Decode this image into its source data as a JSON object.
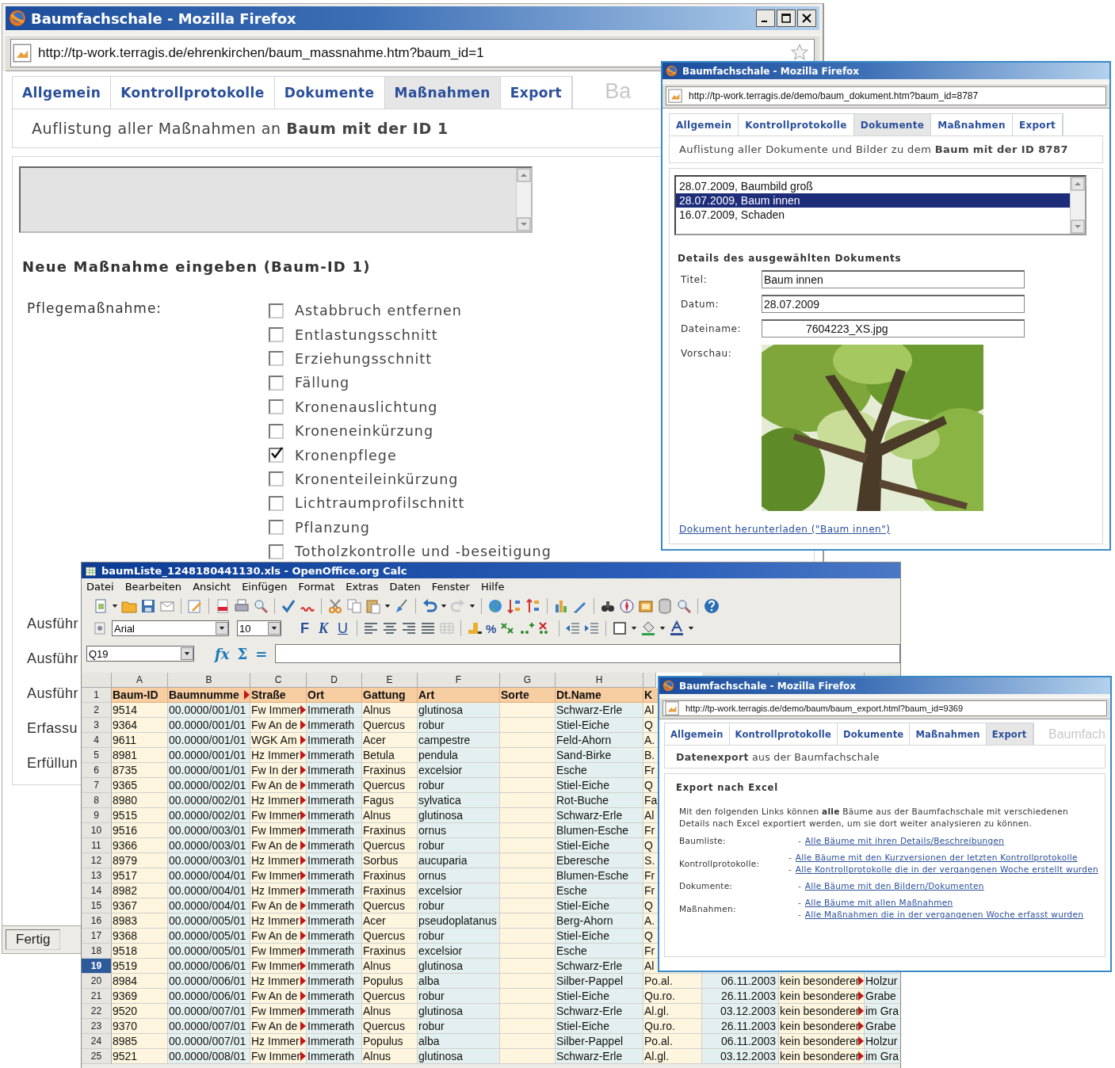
{
  "main_window": {
    "title": "Baumfachschale - Mozilla Firefox",
    "url": "http://tp-work.terragis.de/ehrenkirchen/baum_massnahme.htm?baum_id=1",
    "tabs": [
      {
        "label": "Allgemein",
        "selected": false
      },
      {
        "label": "Kontrollprotokolle",
        "selected": false
      },
      {
        "label": "Dokumente",
        "selected": false
      },
      {
        "label": "Maßnahmen",
        "selected": true
      },
      {
        "label": "Export",
        "selected": false
      }
    ],
    "logo": "Ba",
    "subtitle": "Auflistung aller Maßnahmen an **Baum mit der ID 1**",
    "form_title": "Neue Maßnahme eingeben (Baum-ID 1)",
    "care_label": "Pflegemaßnahme:",
    "care_options": [
      {
        "label": "Astabbruch entfernen",
        "checked": false
      },
      {
        "label": "Entlastungsschnitt",
        "checked": false
      },
      {
        "label": "Erziehungsschnitt",
        "checked": false
      },
      {
        "label": "Fällung",
        "checked": false
      },
      {
        "label": "Kronenauslichtung",
        "checked": false
      },
      {
        "label": "Kroneneinkürzung",
        "checked": false
      },
      {
        "label": "Kronenpflege",
        "checked": true
      },
      {
        "label": "Kronenteileinkürzung",
        "checked": false
      },
      {
        "label": "Lichtraumprofilschnitt",
        "checked": false
      },
      {
        "label": "Pflanzung",
        "checked": false
      },
      {
        "label": "Totholzkontrolle und -beseitigung",
        "checked": false
      }
    ],
    "field_labels": [
      "Ausführ",
      "Ausführ",
      "Ausführ",
      "Erfassu",
      "Erfüllun"
    ],
    "status": "Fertig"
  },
  "document_window": {
    "title": "Baumfachschale - Mozilla Firefox",
    "url": "http://tp-work.terragis.de/demo/baum_dokument.htm?baum_id=8787",
    "tabs": [
      {
        "label": "Allgemein",
        "selected": false
      },
      {
        "label": "Kontrollprotokolle",
        "selected": false
      },
      {
        "label": "Dokumente",
        "selected": true
      },
      {
        "label": "Maßnahmen",
        "selected": false
      },
      {
        "label": "Export",
        "selected": false
      }
    ],
    "subtitle": "Auflistung aller Dokumente und Bilder zu dem **Baum mit der ID 8787**",
    "documents": [
      {
        "label": "28.07.2009, Baumbild groß",
        "selected": false
      },
      {
        "label": "28.07.2009, Baum innen",
        "selected": true
      },
      {
        "label": "16.07.2009, Schaden",
        "selected": false
      }
    ],
    "details_title": "Details des ausgewählten Dokuments",
    "fields": [
      {
        "label": "Titel:",
        "value": "Baum innen"
      },
      {
        "label": "Datum:",
        "value": "28.07.2009"
      },
      {
        "label": "Dateiname:",
        "value": "7604223_XS.jpg"
      }
    ],
    "preview_label": "Vorschau:",
    "download_link": "Dokument herunterladen (\"Baum innen\")"
  },
  "calc_window": {
    "title": "baumListe_1248180441130.xls - OpenOffice.org Calc",
    "menu": [
      "Datei",
      "Bearbeiten",
      "Ansicht",
      "Einfügen",
      "Format",
      "Extras",
      "Daten",
      "Fenster",
      "Hilfe"
    ],
    "font": "Arial",
    "size": "10",
    "format_buttons": [
      "F",
      "K",
      "U"
    ],
    "percent_button": "%",
    "name_box": "Q19",
    "formula_buttons": [
      "fx",
      "Σ",
      "="
    ],
    "columns": [
      "A",
      "B",
      "C",
      "D",
      "E",
      "F",
      "G",
      "H"
    ],
    "rows": [
      {
        "num": "1",
        "selected": false,
        "overflow": {
          "B": true,
          "C": false
        },
        "cells": {
          "A": "Baum-ID",
          "B": "Baumnumme",
          "C": "Straße",
          "D": "Ort",
          "E": "Gattung",
          "F": "Art",
          "G": "Sorte",
          "H": "Dt.Name",
          "I": "K"
        }
      },
      {
        "num": "2",
        "selected": false,
        "overflow": {
          "B": false,
          "C": true
        },
        "cells": {
          "A": "9514",
          "B": "00.0000/001/01",
          "C": "Fw Immer",
          "D": "Immerath",
          "E": "Alnus",
          "F": "glutinosa",
          "H": "Schwarz-Erle",
          "I": "Al"
        }
      },
      {
        "num": "3",
        "selected": false,
        "overflow": {
          "B": false,
          "C": true
        },
        "cells": {
          "A": "9364",
          "B": "00.0000/001/01",
          "C": "Fw An de",
          "D": "Immerath",
          "E": "Quercus",
          "F": "robur",
          "H": "Stiel-Eiche",
          "I": "Q"
        }
      },
      {
        "num": "4",
        "selected": false,
        "overflow": {
          "B": false,
          "C": true
        },
        "cells": {
          "A": "9611",
          "B": "00.0000/001/01",
          "C": "WGK Am",
          "D": "Immerath",
          "E": "Acer",
          "F": "campestre",
          "H": "Feld-Ahorn",
          "I": "A."
        }
      },
      {
        "num": "5",
        "selected": false,
        "overflow": {
          "B": false,
          "C": true
        },
        "cells": {
          "A": "8981",
          "B": "00.0000/001/01",
          "C": "Hz Immer",
          "D": "Immerath",
          "E": "Betula",
          "F": "pendula",
          "H": "Sand-Birke",
          "I": "B."
        }
      },
      {
        "num": "6",
        "selected": false,
        "overflow": {
          "B": false,
          "C": true
        },
        "cells": {
          "A": "8735",
          "B": "00.0000/001/01",
          "C": "Fw In der",
          "D": "Immerath",
          "E": "Fraxinus",
          "F": "excelsior",
          "H": "Esche",
          "I": "Fr"
        }
      },
      {
        "num": "7",
        "selected": false,
        "overflow": {
          "B": false,
          "C": true
        },
        "cells": {
          "A": "9365",
          "B": "00.0000/002/01",
          "C": "Fw An de",
          "D": "Immerath",
          "E": "Quercus",
          "F": "robur",
          "H": "Stiel-Eiche",
          "I": "Q"
        }
      },
      {
        "num": "8",
        "selected": false,
        "overflow": {
          "B": false,
          "C": true
        },
        "cells": {
          "A": "8980",
          "B": "00.0000/002/01",
          "C": "Hz Immer",
          "D": "Immerath",
          "E": "Fagus",
          "F": "sylvatica",
          "H": "Rot-Buche",
          "I": "Fa"
        }
      },
      {
        "num": "9",
        "selected": false,
        "overflow": {
          "B": false,
          "C": true
        },
        "cells": {
          "A": "9515",
          "B": "00.0000/002/01",
          "C": "Fw Immer",
          "D": "Immerath",
          "E": "Alnus",
          "F": "glutinosa",
          "H": "Schwarz-Erle",
          "I": "Al"
        }
      },
      {
        "num": "10",
        "selected": false,
        "overflow": {
          "B": false,
          "C": true
        },
        "cells": {
          "A": "9516",
          "B": "00.0000/003/01",
          "C": "Fw Immer",
          "D": "Immerath",
          "E": "Fraxinus",
          "F": "ornus",
          "H": "Blumen-Esche",
          "I": "Fr"
        }
      },
      {
        "num": "11",
        "selected": false,
        "overflow": {
          "B": false,
          "C": true
        },
        "cells": {
          "A": "9366",
          "B": "00.0000/003/01",
          "C": "Fw An de",
          "D": "Immerath",
          "E": "Quercus",
          "F": "robur",
          "H": "Stiel-Eiche",
          "I": "Q"
        }
      },
      {
        "num": "12",
        "selected": false,
        "overflow": {
          "B": false,
          "C": true
        },
        "cells": {
          "A": "8979",
          "B": "00.0000/003/01",
          "C": "Hz Immer",
          "D": "Immerath",
          "E": "Sorbus",
          "F": "aucuparia",
          "H": "Eberesche",
          "I": "S."
        }
      },
      {
        "num": "13",
        "selected": false,
        "overflow": {
          "B": false,
          "C": true
        },
        "cells": {
          "A": "9517",
          "B": "00.0000/004/01",
          "C": "Fw Immer",
          "D": "Immerath",
          "E": "Fraxinus",
          "F": "ornus",
          "H": "Blumen-Esche",
          "I": "Fr"
        }
      },
      {
        "num": "14",
        "selected": false,
        "overflow": {
          "B": false,
          "C": true
        },
        "cells": {
          "A": "8982",
          "B": "00.0000/004/01",
          "C": "Hz Immer",
          "D": "Immerath",
          "E": "Fraxinus",
          "F": "excelsior",
          "H": "Esche",
          "I": "Fr"
        }
      },
      {
        "num": "15",
        "selected": false,
        "overflow": {
          "B": false,
          "C": true
        },
        "cells": {
          "A": "9367",
          "B": "00.0000/004/01",
          "C": "Fw An de",
          "D": "Immerath",
          "E": "Quercus",
          "F": "robur",
          "H": "Stiel-Eiche",
          "I": "Q"
        }
      },
      {
        "num": "16",
        "selected": false,
        "overflow": {
          "B": false,
          "C": true
        },
        "cells": {
          "A": "8983",
          "B": "00.0000/005/01",
          "C": "Hz Immer",
          "D": "Immerath",
          "E": "Acer",
          "F": "pseudoplatanus",
          "H": "Berg-Ahorn",
          "I": "A."
        }
      },
      {
        "num": "17",
        "selected": false,
        "overflow": {
          "B": false,
          "C": true
        },
        "cells": {
          "A": "9368",
          "B": "00.0000/005/01",
          "C": "Fw An de",
          "D": "Immerath",
          "E": "Quercus",
          "F": "robur",
          "H": "Stiel-Eiche",
          "I": "Q"
        }
      },
      {
        "num": "18",
        "selected": false,
        "overflow": {
          "B": false,
          "C": true
        },
        "cells": {
          "A": "9518",
          "B": "00.0000/005/01",
          "C": "Fw Immer",
          "D": "Immerath",
          "E": "Fraxinus",
          "F": "excelsior",
          "H": "Esche",
          "I": "Fr"
        }
      },
      {
        "num": "19",
        "selected": true,
        "overflow": {
          "B": false,
          "C": true
        },
        "cells": {
          "A": "9519",
          "B": "00.0000/006/01",
          "C": "Fw Immer",
          "D": "Immerath",
          "E": "Alnus",
          "F": "glutinosa",
          "H": "Schwarz-Erle",
          "I": "Al"
        }
      },
      {
        "num": "20",
        "selected": false,
        "overflow": {
          "B": false,
          "C": true,
          "K": true
        },
        "cells": {
          "A": "8984",
          "B": "00.0000/006/01",
          "C": "Hz Immer",
          "D": "Immerath",
          "E": "Populus",
          "F": "alba",
          "H": "Silber-Pappel",
          "I": "Po.al.",
          "J": "06.11.2003",
          "K": "kein besonderer",
          "L": "Holzur"
        }
      },
      {
        "num": "21",
        "selected": false,
        "overflow": {
          "B": false,
          "C": true,
          "K": true
        },
        "cells": {
          "A": "9369",
          "B": "00.0000/006/01",
          "C": "Fw An de",
          "D": "Immerath",
          "E": "Quercus",
          "F": "robur",
          "H": "Stiel-Eiche",
          "I": "Qu.ro.",
          "J": "26.11.2003",
          "K": "kein besonderer",
          "L": "Grabe"
        }
      },
      {
        "num": "22",
        "selected": false,
        "overflow": {
          "B": false,
          "C": true,
          "K": true
        },
        "cells": {
          "A": "9520",
          "B": "00.0000/007/01",
          "C": "Fw Immer",
          "D": "Immerath",
          "E": "Alnus",
          "F": "glutinosa",
          "H": "Schwarz-Erle",
          "I": "Al.gl.",
          "J": "03.12.2003",
          "K": "kein besonderer",
          "L": "im Gra"
        }
      },
      {
        "num": "23",
        "selected": false,
        "overflow": {
          "B": false,
          "C": true,
          "K": true
        },
        "cells": {
          "A": "9370",
          "B": "00.0000/007/01",
          "C": "Fw An de",
          "D": "Immerath",
          "E": "Quercus",
          "F": "robur",
          "H": "Stiel-Eiche",
          "I": "Qu.ro.",
          "J": "26.11.2003",
          "K": "kein besonderer",
          "L": "Grabe"
        }
      },
      {
        "num": "24",
        "selected": false,
        "overflow": {
          "B": false,
          "C": true,
          "K": true
        },
        "cells": {
          "A": "8985",
          "B": "00.0000/007/01",
          "C": "Hz Immer",
          "D": "Immerath",
          "E": "Populus",
          "F": "alba",
          "H": "Silber-Pappel",
          "I": "Po.al.",
          "J": "06.11.2003",
          "K": "kein besonderer",
          "L": "Holzur"
        }
      },
      {
        "num": "25",
        "selected": false,
        "overflow": {
          "B": false,
          "C": true,
          "K": true
        },
        "cells": {
          "A": "9521",
          "B": "00.0000/008/01",
          "C": "Fw Immer",
          "D": "Immerath",
          "E": "Alnus",
          "F": "glutinosa",
          "H": "Schwarz-Erle",
          "I": "Al.gl.",
          "J": "03.12.2003",
          "K": "kein besonderer",
          "L": "im Gra"
        }
      }
    ]
  },
  "export_window": {
    "title": "Baumfachschale - Mozilla Firefox",
    "url": "http://tp-work.terragis.de/demo/baum/baum_export.html?baum_id=9369",
    "tabs": [
      {
        "label": "Allgemein",
        "selected": false
      },
      {
        "label": "Kontrollprotokolle",
        "selected": false
      },
      {
        "label": "Dokumente",
        "selected": false
      },
      {
        "label": "Maßnahmen",
        "selected": false
      },
      {
        "label": "Export",
        "selected": true
      }
    ],
    "logo": "Baumfach",
    "subtitle": "**Datenexport** aus der Baumfachschale",
    "section_title": "Export nach Excel",
    "intro": "Mit den folgenden Links können **alle** Bäume aus der Baumfachschale mit verschiedenen Details nach Excel exportiert werden, um sie dort weiter analysieren zu können.",
    "groups": [
      {
        "label": "Baumliste:",
        "links": [
          {
            "bullet": "-",
            "text": "Alle Bäume mit ihren Details/Beschreibungen"
          }
        ]
      },
      {
        "label": "Kontrollprotokolle:",
        "links": [
          {
            "bullet": "-",
            "text": "Alle Bäume mit den Kurzversionen der letzten Kontrollprotokolle"
          },
          {
            "bullet": "-",
            "text": "Alle Kontrollprotokolle die in der vergangenen Woche erstellt wurden"
          }
        ]
      },
      {
        "label": "Dokumente:",
        "links": [
          {
            "bullet": "-",
            "text": "Alle Bäume mit den Bildern/Dokumenten"
          }
        ]
      },
      {
        "label": "Maßnahmen:",
        "links": [
          {
            "bullet": "-",
            "text": "Alle Bäume mit allen Maßnahmen"
          },
          {
            "bullet": "-",
            "text": "Alle Maßnahmen die in der vergangenen Woche erfasst wurden"
          }
        ]
      }
    ]
  }
}
